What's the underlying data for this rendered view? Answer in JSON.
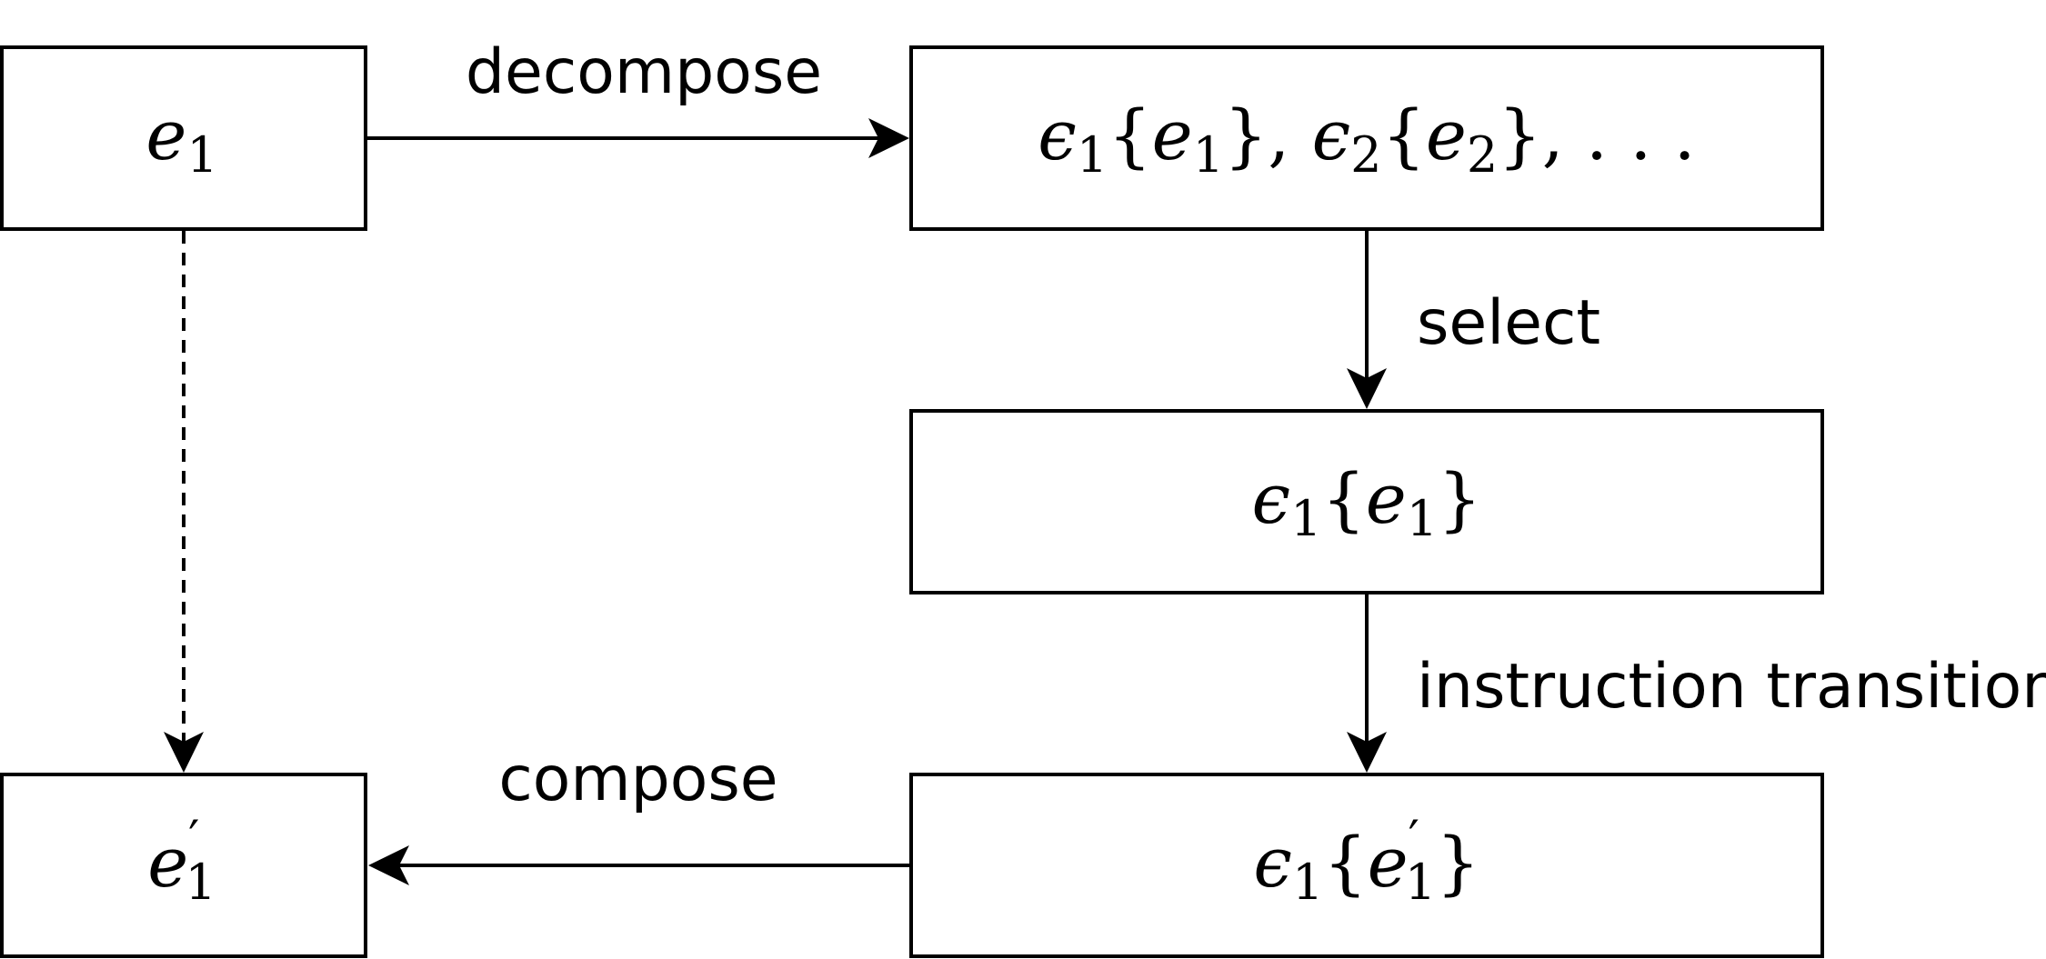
{
  "nodes": {
    "e1": {
      "main": "e",
      "sub": "1"
    },
    "decomposed": {
      "parts": [
        {
          "t": "ϵ",
          "style": "math"
        },
        {
          "t": "1",
          "style": "sub"
        },
        {
          "t": "{",
          "style": "up"
        },
        {
          "t": "e",
          "style": "math"
        },
        {
          "t": "1",
          "style": "sub"
        },
        {
          "t": "}, ",
          "style": "up"
        },
        {
          "t": "ϵ",
          "style": "math"
        },
        {
          "t": "2",
          "style": "sub"
        },
        {
          "t": "{",
          "style": "up"
        },
        {
          "t": "e",
          "style": "math"
        },
        {
          "t": "2",
          "style": "sub"
        },
        {
          "t": "}, . . .",
          "style": "up"
        }
      ]
    },
    "selected": {
      "parts": [
        {
          "t": "ϵ",
          "style": "math"
        },
        {
          "t": "1",
          "style": "sub"
        },
        {
          "t": "{",
          "style": "up"
        },
        {
          "t": "e",
          "style": "math"
        },
        {
          "t": "1",
          "style": "sub"
        },
        {
          "t": "}",
          "style": "up"
        }
      ]
    },
    "transitioned": {
      "parts": [
        {
          "t": "ϵ",
          "style": "math"
        },
        {
          "t": "1",
          "style": "sub"
        },
        {
          "t": "{",
          "style": "up"
        },
        {
          "t": "e",
          "style": "math"
        },
        {
          "t": "′",
          "style": "sup"
        },
        {
          "t": "1",
          "style": "sub"
        },
        {
          "t": "}",
          "style": "up"
        }
      ]
    },
    "e1_prime": {
      "main": "e",
      "prime": "′",
      "sub": "1"
    }
  },
  "edges": {
    "decompose": "decompose",
    "select": "select",
    "instruction_transition": "instruction transition",
    "compose": "compose"
  }
}
